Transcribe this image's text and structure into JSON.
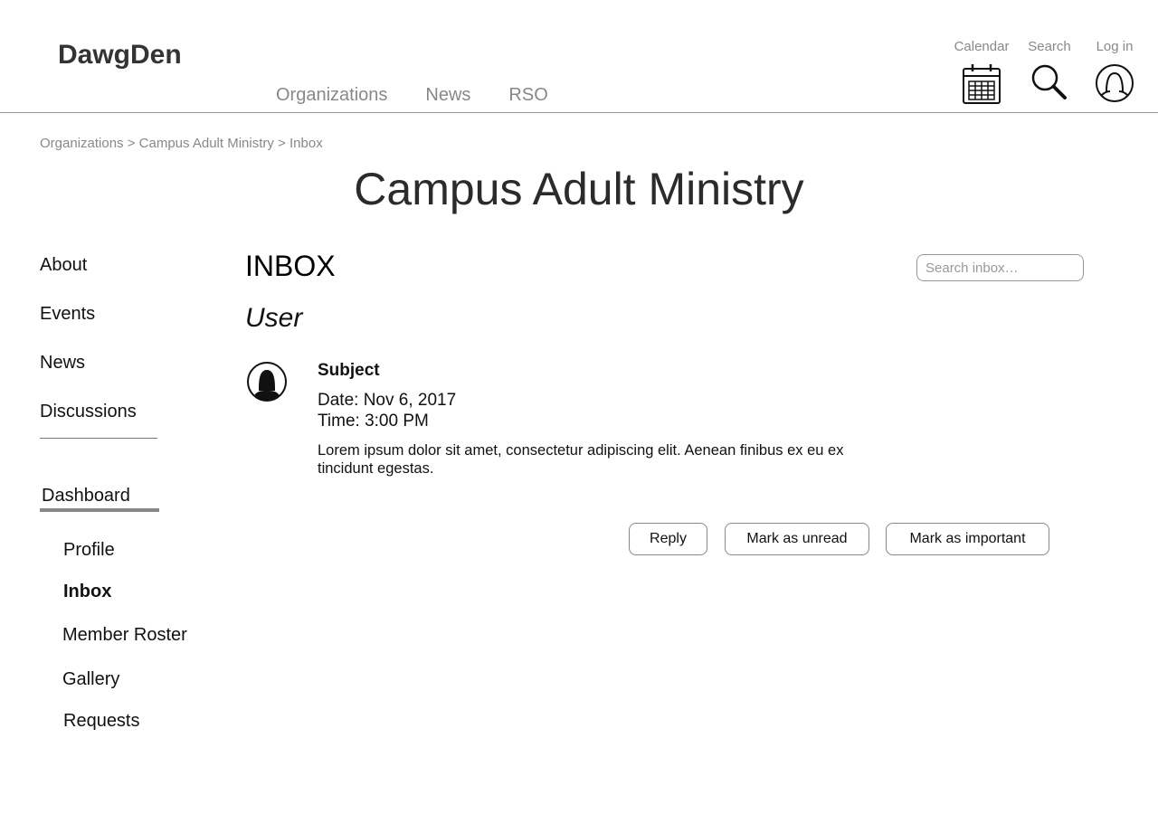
{
  "header": {
    "logo": "DawgDen",
    "nav": [
      "Organizations",
      "News",
      "RSO"
    ],
    "tools": {
      "calendar_label": "Calendar",
      "search_label": "Search",
      "login_label": "Log in"
    }
  },
  "breadcrumb": {
    "items": [
      "Organizations",
      "Campus Adult Ministry",
      "Inbox"
    ],
    "separator": ">"
  },
  "page_title": "Campus Adult Ministry",
  "sidebar": {
    "items": [
      "About",
      "Events",
      "News",
      "Discussions"
    ],
    "dashboard_label": "Dashboard",
    "dashboard_items": [
      "Profile",
      "Inbox",
      "Member Roster",
      "Gallery",
      "Requests"
    ],
    "active_item": "Inbox"
  },
  "main": {
    "title": "INBOX",
    "search_placeholder": "Search inbox…",
    "user_label": "User",
    "message": {
      "subject": "Subject",
      "date": "Date: Nov 6, 2017",
      "time": "Time: 3:00 PM",
      "body": "Lorem ipsum dolor sit amet, consectetur adipiscing elit. Aenean finibus ex eu ex tincidunt egestas."
    },
    "actions": {
      "reply": "Reply",
      "mark_unread": "Mark as unread",
      "mark_important": "Mark as important"
    }
  },
  "colors": {
    "text": "#111111",
    "muted": "#888888",
    "divider": "#999999",
    "accent_underline": "#888888"
  }
}
